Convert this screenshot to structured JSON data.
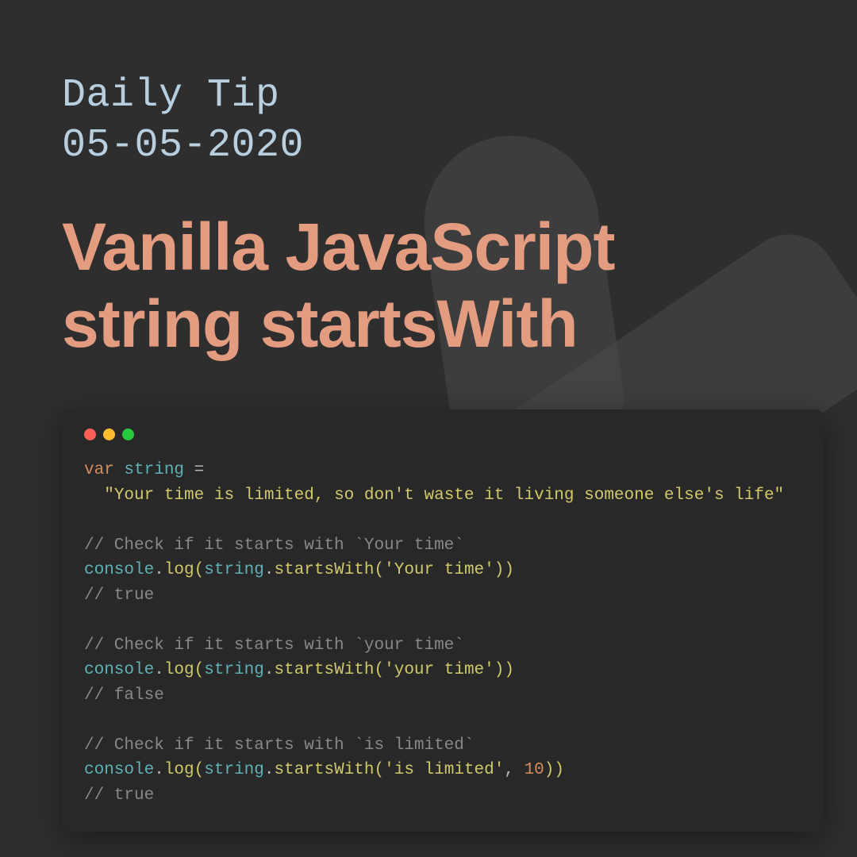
{
  "subtitle_line1": "Daily Tip",
  "subtitle_line2": "05-05-2020",
  "title_line1": "Vanilla JavaScript",
  "title_line2": "string startsWith",
  "code": {
    "kw_var": "var",
    "ident_string": "string",
    "eq": " =",
    "str_main": "\"Your time is limited, so don't waste it living someone else's life\"",
    "c1": "// Check if it starts with `Your time`",
    "console": "console",
    "log": "log",
    "startsWith": "startsWith",
    "arg1": "'Your time'",
    "r1": "// true",
    "c2": "// Check if it starts with `your time`",
    "arg2": "'your time'",
    "r2": "// false",
    "c3": "// Check if it starts with `is limited`",
    "arg3": "'is limited'",
    "num10": "10",
    "r3": "// true"
  }
}
